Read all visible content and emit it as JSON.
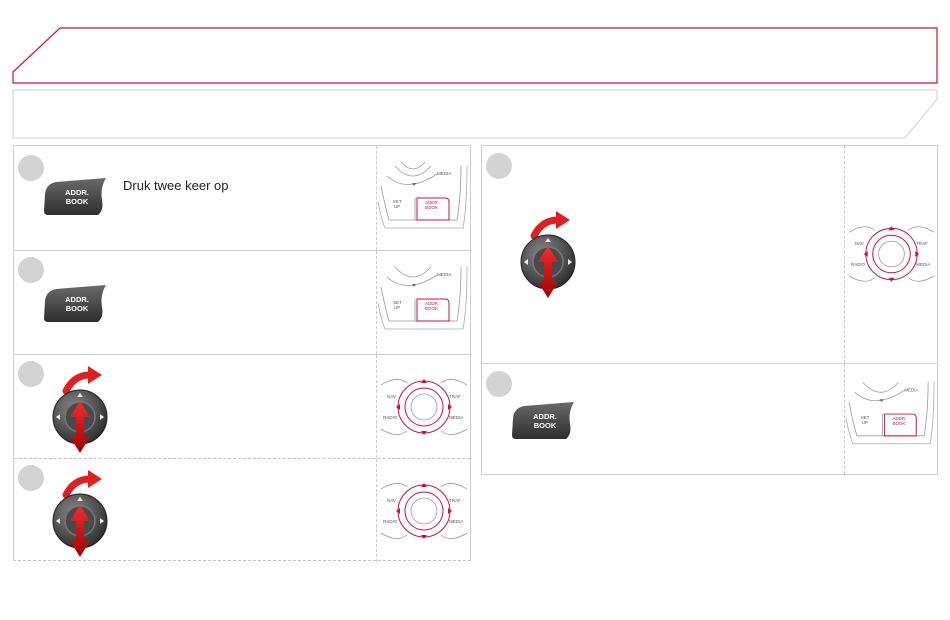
{
  "colors": {
    "accent": "#d0103a",
    "button_dark": "#444444",
    "step_circle": "#d3d3d3",
    "border": "#cfcfcf"
  },
  "steps": {
    "s1": {
      "instruction": "Druk twee keer op",
      "button": [
        "ADDR.",
        "BOOK"
      ],
      "illus": "addr-book-panel"
    },
    "s2": {
      "button": [
        "ADDR.",
        "BOOK"
      ],
      "illus": "addr-book-panel"
    },
    "s3": {
      "illus": "navigation-dial"
    },
    "s4": {
      "illus": "navigation-dial"
    },
    "s5": {
      "illus": "navigation-dial"
    },
    "s6": {
      "button": [
        "ADDR.",
        "BOOK"
      ],
      "illus": "addr-book-panel"
    }
  },
  "panel_labels": {
    "media": "MEDIA",
    "setup_1": "SET",
    "setup_2": "UP",
    "addr_1": "ADDR.",
    "addr_2": "BOOK"
  },
  "dial_labels": {
    "nav": "NAV",
    "traf": "TRAF",
    "radio": "RADIO",
    "media": "MEDIA"
  }
}
